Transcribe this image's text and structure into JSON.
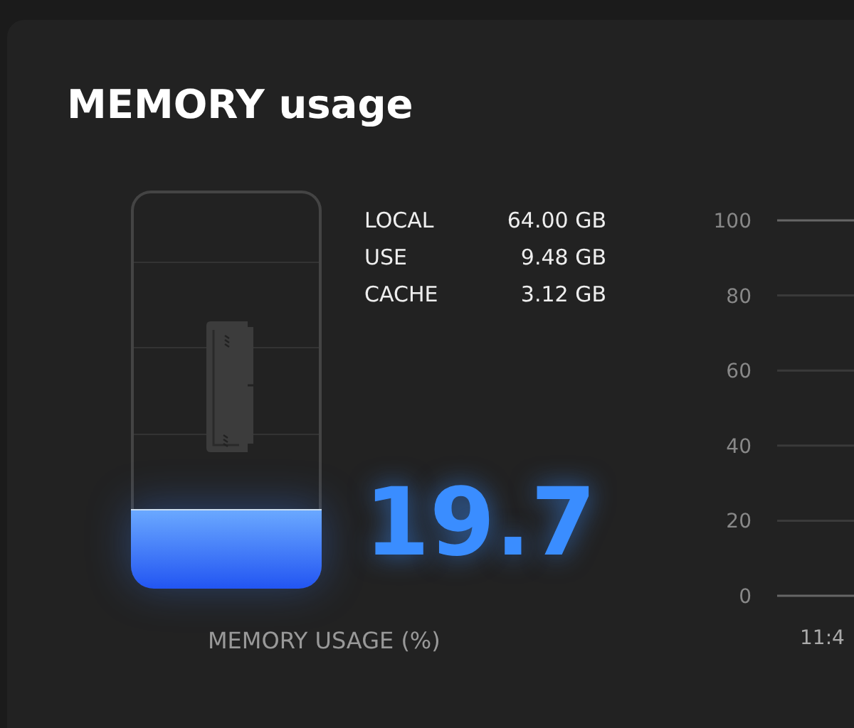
{
  "title": "MEMORY usage",
  "stats": [
    {
      "label": "LOCAL",
      "value": "64.00 GB"
    },
    {
      "label": "USE",
      "value": "9.48 GB"
    },
    {
      "label": "CACHE",
      "value": "3.12 GB"
    }
  ],
  "gauge": {
    "level": 0.197,
    "reading": "19.7",
    "caption": "MEMORY USAGE (%)"
  },
  "axis": {
    "y_labels": [
      "100",
      "80",
      "60",
      "40",
      "20",
      "0"
    ],
    "x_label": "11:4"
  }
}
